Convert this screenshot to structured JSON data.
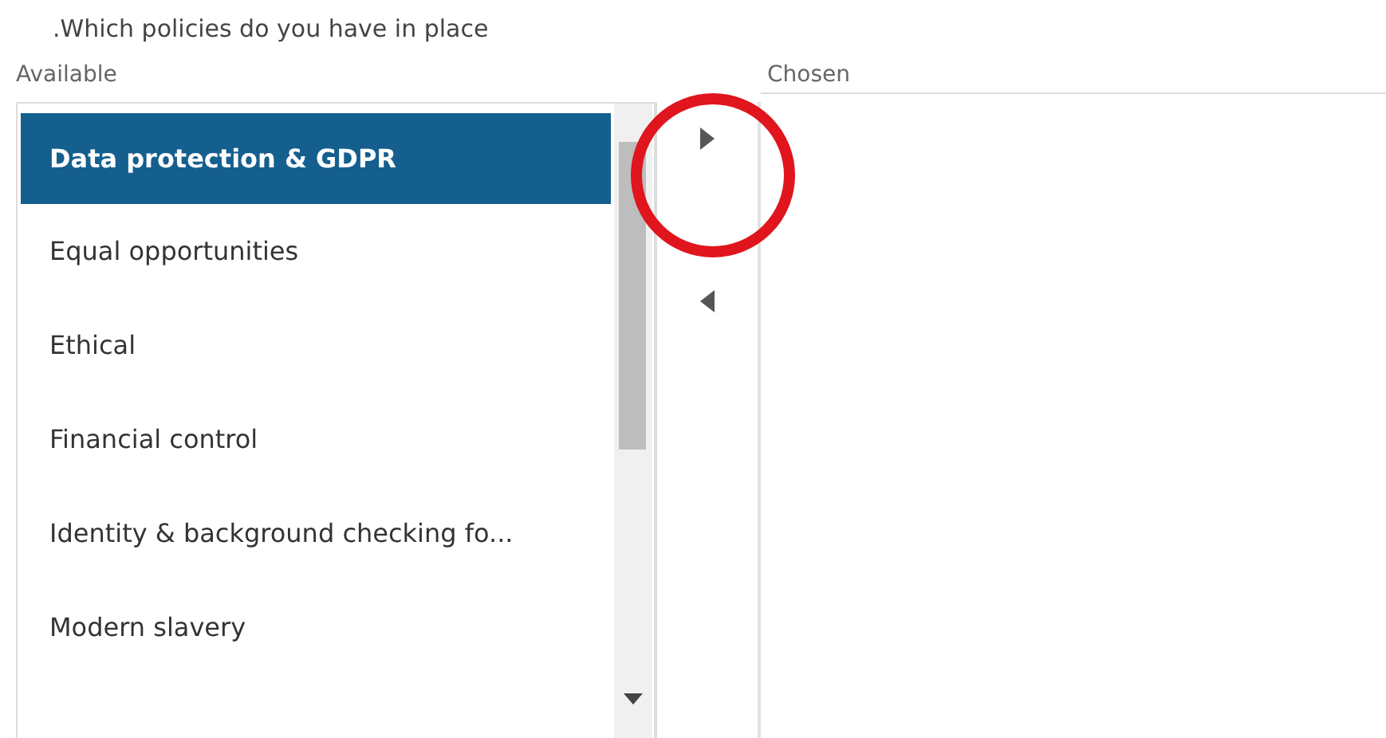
{
  "question": ".Which policies do you have in place",
  "available": {
    "label": "Available",
    "items": [
      {
        "label": "Data protection & GDPR",
        "selected": true
      },
      {
        "label": "Equal opportunities",
        "selected": false
      },
      {
        "label": "Ethical",
        "selected": false
      },
      {
        "label": "Financial control",
        "selected": false
      },
      {
        "label": "Identity & background checking fo...",
        "selected": false
      },
      {
        "label": "Modern slavery",
        "selected": false
      }
    ]
  },
  "move_buttons": [
    {
      "kind": "add"
    },
    {
      "kind": "remove"
    }
  ],
  "chosen": {
    "label": "Chosen"
  },
  "annotation": {
    "kind": "circle"
  }
}
